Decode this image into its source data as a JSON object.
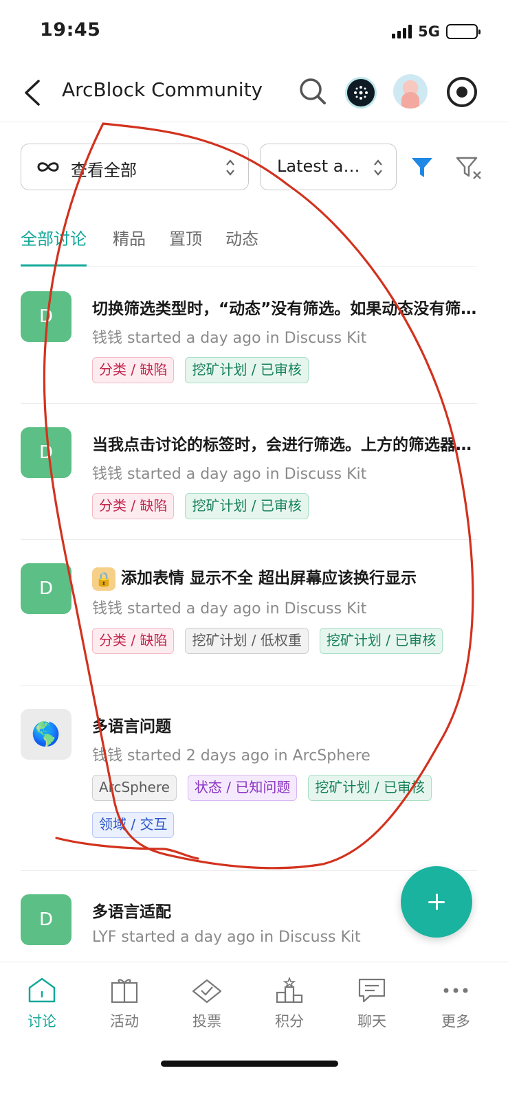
{
  "status_bar": {
    "time": "19:45",
    "network": "5G"
  },
  "header": {
    "title": "ArcBlock Community"
  },
  "filters": {
    "category_label": "查看全部",
    "sort_label": "Latest activity"
  },
  "tabs": [
    {
      "label": "全部讨论",
      "active": true
    },
    {
      "label": "精品",
      "active": false
    },
    {
      "label": "置顶",
      "active": false
    },
    {
      "label": "动态",
      "active": false
    }
  ],
  "posts": [
    {
      "avatar": "D",
      "title": "切换筛选类型时，“动态”没有筛选。如果动态没有筛选功能",
      "meta": "钱钱 started a day ago in Discuss Kit",
      "tags": [
        "分类 / 缺陷",
        "挖矿计划 / 已审核"
      ]
    },
    {
      "avatar": "D",
      "title": "当我点击讨论的标签时，会进行筛选。上方的筛选器没有变化",
      "meta": "钱钱 started a day ago in Discuss Kit",
      "tags": [
        "分类 / 缺陷",
        "挖矿计划 / 已审核"
      ]
    },
    {
      "avatar": "D",
      "title": "添加表情 显示不全 超出屏幕应该换行显示",
      "meta": "钱钱 started a day ago in Discuss Kit",
      "tags": [
        "分类 / 缺陷",
        "挖矿计划 / 低权重",
        "挖矿计划 / 已审核"
      ]
    },
    {
      "avatar": "🌎",
      "title": "多语言问题",
      "meta": "钱钱 started 2 days ago in ArcSphere",
      "tags": [
        "ArcSphere",
        "状态 / 已知问题",
        "挖矿计划 / 已审核",
        "领域 / 交互"
      ]
    },
    {
      "avatar": "D",
      "title": "多语言适配",
      "meta": "LYF started a day ago in Discuss Kit",
      "tags": []
    }
  ],
  "bottom_nav": [
    {
      "label": "讨论",
      "icon": "home-icon",
      "active": true
    },
    {
      "label": "活动",
      "icon": "gift-icon",
      "active": false
    },
    {
      "label": "投票",
      "icon": "vote-icon",
      "active": false
    },
    {
      "label": "积分",
      "icon": "podium-icon",
      "active": false
    },
    {
      "label": "聊天",
      "icon": "chat-icon",
      "active": false
    },
    {
      "label": "更多",
      "icon": "more-icon",
      "active": false
    }
  ],
  "colors": {
    "accent": "#12a89a",
    "fab": "#19b39f",
    "avatar_green": "#5cbf86",
    "annotation_red": "#d2321e"
  }
}
